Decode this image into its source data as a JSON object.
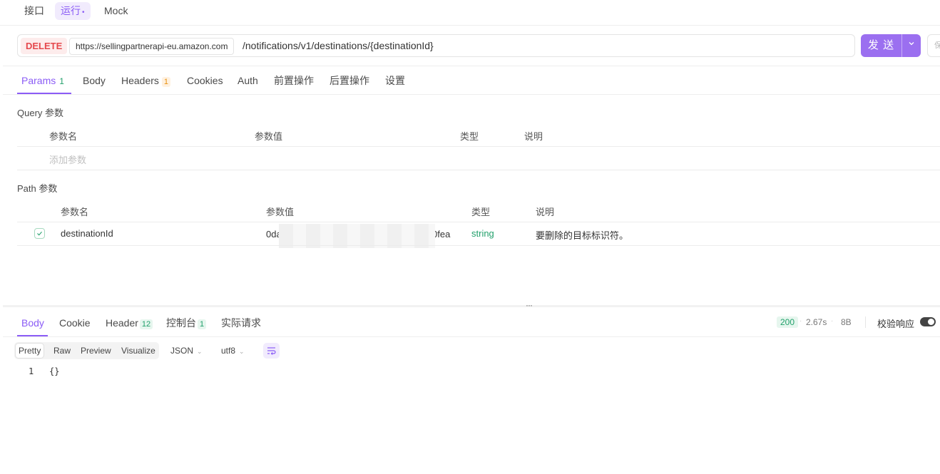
{
  "top_tabs": [
    {
      "label": "接口"
    },
    {
      "label": "运行",
      "dot": "•"
    },
    {
      "label": "Mock"
    }
  ],
  "request": {
    "method": "DELETE",
    "host": "https://sellingpartnerapi-eu.amazon.com",
    "path": "/notifications/v1/destinations/{destinationId}",
    "send_label": "发 送",
    "save_label": "保"
  },
  "colors": {
    "accent": "#8b5cf6",
    "send_button": "#9b6ff0",
    "method_delete": "#e5484d",
    "success": "#22a06b"
  },
  "request_tabs": [
    {
      "label": "Params",
      "badge": "1"
    },
    {
      "label": "Body"
    },
    {
      "label": "Headers",
      "badge": "1"
    },
    {
      "label": "Cookies"
    },
    {
      "label": "Auth"
    },
    {
      "label": "前置操作"
    },
    {
      "label": "后置操作"
    },
    {
      "label": "设置"
    }
  ],
  "query_section": {
    "title": "Query 参数",
    "columns": [
      "参数名",
      "参数值",
      "类型",
      "说明"
    ],
    "placeholder": "添加参数"
  },
  "path_section": {
    "title": "Path 参数",
    "columns": [
      "参数名",
      "参数值",
      "类型",
      "说明"
    ],
    "rows": [
      {
        "checked": true,
        "name": "destinationId",
        "value_start": "0da",
        "value_end": "0fea",
        "type": "string",
        "description": "要删除的目标标识符。"
      }
    ]
  },
  "resize_handle": "···",
  "response_tabs": [
    {
      "label": "Body"
    },
    {
      "label": "Cookie"
    },
    {
      "label": "Header",
      "badge": "12"
    },
    {
      "label": "控制台",
      "badge": "1"
    },
    {
      "label": "实际请求"
    }
  ],
  "response_meta": {
    "status": "200",
    "time": "2.67s",
    "size": "8B",
    "validate_label": "校验响应",
    "validate_on": true,
    "separator": "·"
  },
  "view_modes": [
    "Pretty",
    "Raw",
    "Preview",
    "Visualize"
  ],
  "format": "JSON",
  "encoding": "utf8",
  "icons": {
    "dropdown": "chevron-down-icon",
    "check": "check-icon",
    "wrap": "word-wrap-icon"
  },
  "response_body": {
    "line_number": "1",
    "text": "{}"
  }
}
